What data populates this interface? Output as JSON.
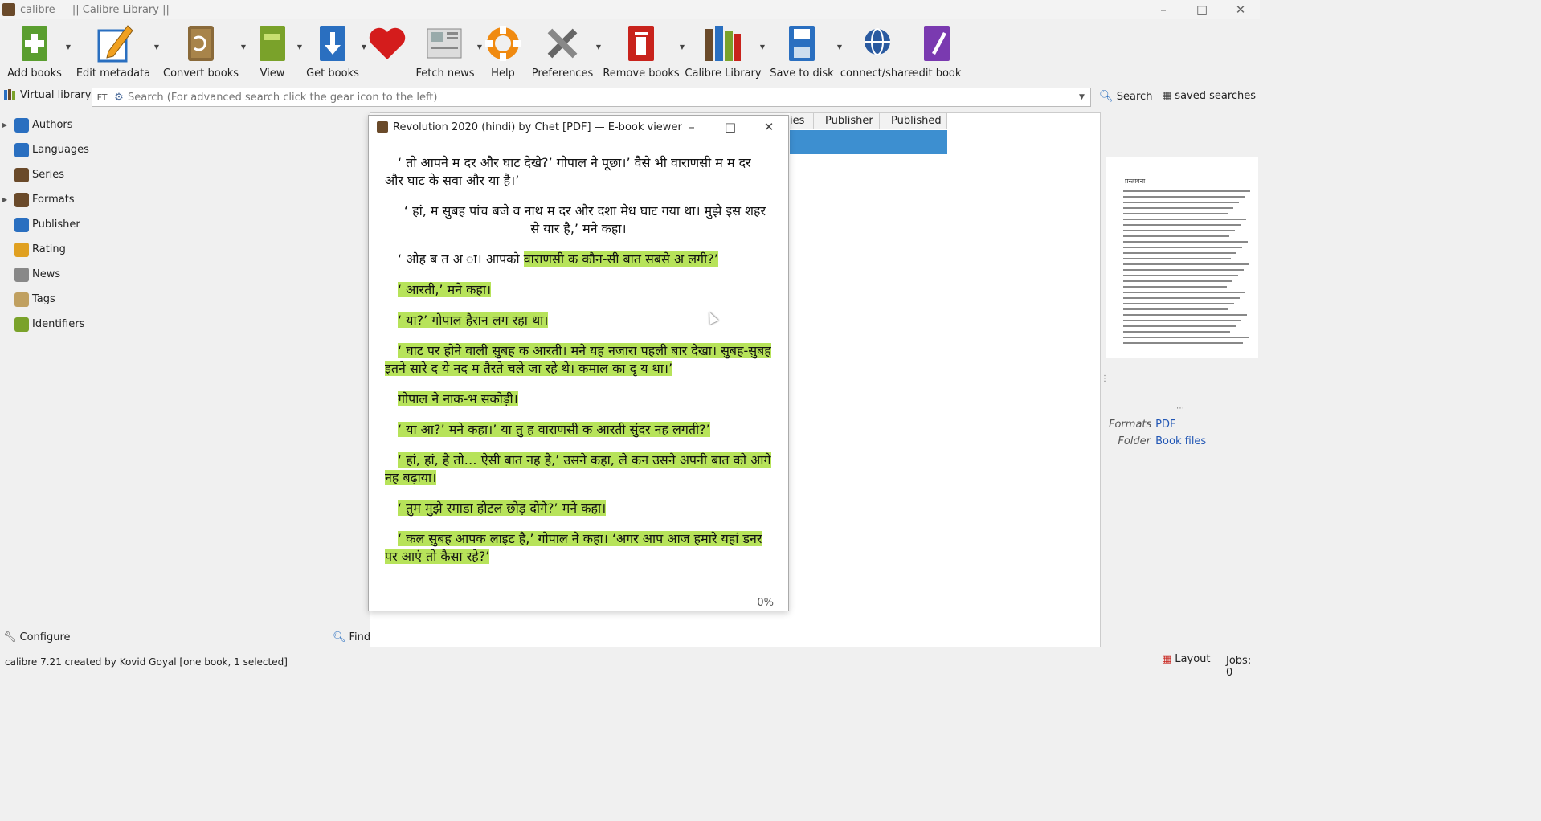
{
  "window": {
    "title": "calibre — || Calibre Library ||"
  },
  "toolbar": {
    "add_books": "Add books",
    "edit_metadata": "Edit metadata",
    "convert_books": "Convert books",
    "view": "View",
    "get_books": "Get books",
    "fetch_news": "Fetch news",
    "help": "Help",
    "preferences": "Preferences",
    "remove_books": "Remove books",
    "calibre_library": "Calibre Library",
    "save_to_disk": "Save to disk",
    "connect_share": "connect/share",
    "edit_book": "edit book"
  },
  "search": {
    "virtual_library": "Virtual library",
    "ft_label": "FT",
    "placeholder": "Search (For advanced search click the gear icon to the left)",
    "search_button": "Search",
    "saved_searches": "saved searches"
  },
  "tag_browser": {
    "items": [
      {
        "label": "Authors",
        "expandable": true,
        "icon": "person-icon"
      },
      {
        "label": "Languages",
        "expandable": false,
        "icon": "languages-icon"
      },
      {
        "label": "Series",
        "expandable": false,
        "icon": "series-icon"
      },
      {
        "label": "Formats",
        "expandable": true,
        "icon": "formats-icon"
      },
      {
        "label": "Publisher",
        "expandable": false,
        "icon": "publisher-icon"
      },
      {
        "label": "Rating",
        "expandable": false,
        "icon": "star-icon"
      },
      {
        "label": "News",
        "expandable": false,
        "icon": "news-icon"
      },
      {
        "label": "Tags",
        "expandable": false,
        "icon": "tag-icon"
      },
      {
        "label": "Identifiers",
        "expandable": false,
        "icon": "barcode-icon"
      }
    ],
    "configure": "Configure",
    "find": "Find"
  },
  "book_list": {
    "columns": [
      "ies",
      "Publisher",
      "Published"
    ]
  },
  "book_details": {
    "cover_heading": "प्रस्तावना",
    "formats_label": "Formats",
    "formats_value": "PDF",
    "folder_label": "Folder",
    "folder_value": "Book files"
  },
  "viewer": {
    "title": "Revolution 2020 (hindi) by Chet [PDF] — E-book viewer",
    "paragraphs": [
      {
        "pre": "‘ तो आपने म दर और घाट देखे?’ गोपाल ने पूछा।’ वैसे भी वाराणसी म म दर और घाट के सवा और या है।’",
        "hl": ""
      },
      {
        "pre": "‘ हां, म सुबह पांच बजे व नाथ म दर और दशा मेध घाट गया था। मुझे इस शहर से यार है,’ मने कहा।",
        "hl": ""
      },
      {
        "pre": "‘ ओह ब त अ ा। आपको ",
        "hl": "वाराणसी क कौन-सी बात सबसे अ लगी?’"
      },
      {
        "pre": "",
        "hl": "‘ आरती,’ मने कहा।"
      },
      {
        "pre": "",
        "hl": "‘ या?’ गोपाल हैरान लग रहा था।"
      },
      {
        "pre": "",
        "hl": "‘ घाट पर होने वाली सुबह क आरती। मने यह नजारा पहली बार देखा। सुबह-सुबह इतने सारे द ये नद म तैरते चले जा रहे थे। कमाल का दृ य था।’"
      },
      {
        "pre": "",
        "hl": "गोपाल ने नाक-भ सकोड़ी।"
      },
      {
        "pre": "",
        "hl": "‘ या आ?’ मने कहा।’ या तु ह वाराणसी क आरती सुंदर नह लगती?’"
      },
      {
        "pre": "",
        "hl": "‘ हां, हां, है तो… ऐसी बात नह है,’ उसने कहा, ले कन उसने अपनी बात को आगे नह बढ़ाया।"
      },
      {
        "pre": "",
        "hl": "‘ तुम मुझे रमाडा होटल छोड़ दोगे?’ मने कहा।"
      },
      {
        "pre": "",
        "hl": "‘ कल सुबह आपक लाइट है,’ गोपाल ने कहा। ‘अगर आप आज हमारे यहां डनर पर आएं तो कैसा रहे?’"
      }
    ],
    "progress": "0%"
  },
  "status": {
    "text": "calibre 7.21 created by Kovid Goyal   [one book, 1 selected]",
    "layout": "Layout",
    "jobs": "Jobs: 0"
  },
  "colors": {
    "highlight": "#b7e35a",
    "selection": "#3d8fd0",
    "link": "#2257b5"
  }
}
